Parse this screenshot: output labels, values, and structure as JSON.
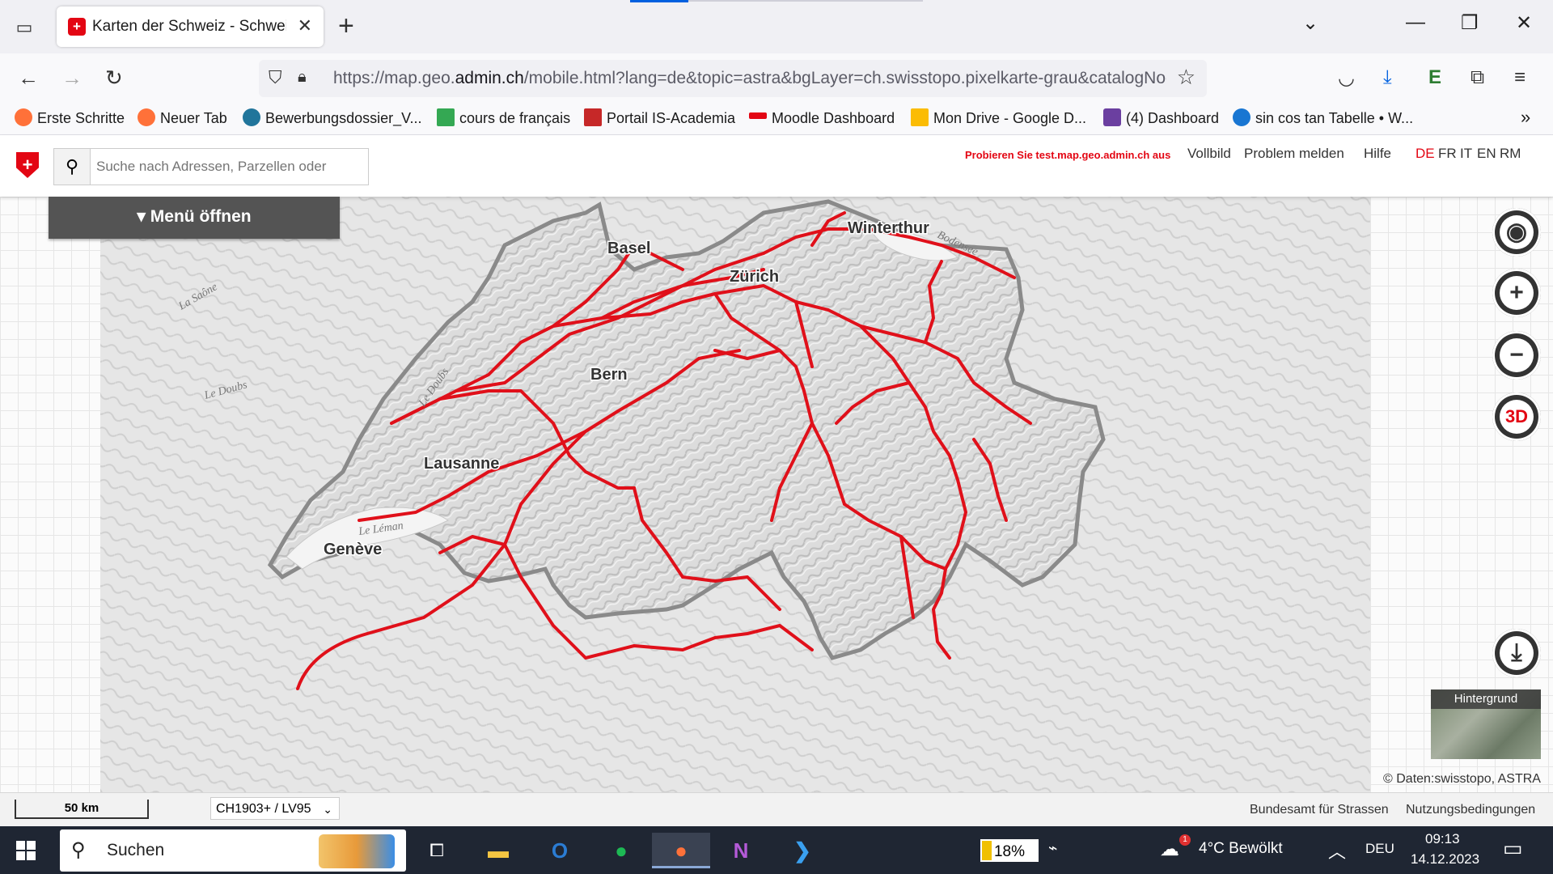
{
  "browser": {
    "tab_title": "Karten der Schweiz - Schweizerische Eidgenossenschaft",
    "url_prefix": "https://map.geo.",
    "url_domain": "admin.ch",
    "url_rest": "/mobile.html?lang=de&topic=astra&bgLayer=ch.swisstopo.pixelkarte-grau&catalogNodes",
    "bookmarks": [
      {
        "label": "Erste Schritte",
        "color": "#ff7139"
      },
      {
        "label": "Neuer Tab",
        "color": "#ff7139"
      },
      {
        "label": "Bewerbungsdossier_V...",
        "color": "#21759b"
      },
      {
        "label": "cours de français",
        "color": "#34a853"
      },
      {
        "label": "Portail IS-Academia",
        "color": "#c62828"
      },
      {
        "label": "Moodle Dashboard",
        "color": "#e30613"
      },
      {
        "label": "Mon Drive - Google D...",
        "color": "#fbbc04"
      },
      {
        "label": "(4) Dashboard",
        "color": "#6b3fa0"
      },
      {
        "label": "sin cos tan Tabelle • W...",
        "color": "#1976d2"
      }
    ]
  },
  "geoadmin": {
    "search_placeholder": "Suche nach Adressen, Parzellen oder",
    "promo": "Probieren Sie test.map.geo.admin.ch aus",
    "links": [
      "Vollbild",
      "Problem melden",
      "Hilfe"
    ],
    "languages": [
      "DE",
      "FR",
      "IT",
      "EN",
      "RM"
    ],
    "active_language": "DE",
    "menu_label": "Menü öffnen",
    "controls": [
      "locate-icon",
      "zoom-in-icon",
      "zoom-out-icon",
      "3D"
    ],
    "background_label": "Hintergrund",
    "copyright": "© Daten:swisstopo, ASTRA"
  },
  "map": {
    "cities": [
      "Basel",
      "Winterthur",
      "Zürich",
      "Bern",
      "Lausanne",
      "Genève"
    ],
    "water_labels": [
      "Bodensee",
      "Le Léman",
      "Le Doubs",
      "La Saône",
      "Le Doubs"
    ],
    "route_color": "#e0101a"
  },
  "footer": {
    "scale": "50 km",
    "crs": "CH1903+ / LV95",
    "links": [
      "Bundesamt für Strassen",
      "Nutzungsbedingungen"
    ]
  },
  "taskbar": {
    "search": "Suchen",
    "battery": "18%",
    "weather": "4°C  Bewölkt",
    "language": "DEU",
    "time": "09:13",
    "date": "14.12.2023",
    "notification_badge": "1"
  }
}
